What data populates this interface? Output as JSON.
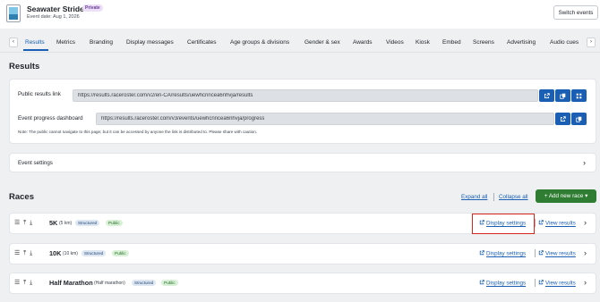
{
  "header": {
    "event_name": "Seawater Stride",
    "privacy_badge": "Private",
    "event_date": "Event date: Aug 1, 2026",
    "switch_label": "Switch events"
  },
  "tabs": {
    "prev_icon": "chevron-left-icon",
    "next_icon": "chevron-right-icon",
    "items": [
      "Results",
      "Metrics",
      "Branding",
      "Display messages",
      "Certificates",
      "Age groups & divisions",
      "Gender & sex",
      "Awards",
      "Videos",
      "Kiosk",
      "Embed",
      "Screens",
      "Advertising",
      "Audio cues"
    ],
    "active": "Results"
  },
  "page": {
    "title": "Results"
  },
  "links_card": {
    "public_label": "Public results link",
    "public_value": "https://results.raceroster.com/v2/en-CA/results/uewhcnncea6nhvja/results",
    "progress_label": "Event progress dashboard",
    "progress_value": "https://results.raceroster.com/v3/events/uewhcnncea6nhvja/progress",
    "note": "Note: The public cannot navigate to this page; but it can be accessed by anyone the link is distributed to. Please share with caution.",
    "icons": [
      "external-link-icon",
      "copy-icon",
      "qr-code-icon"
    ]
  },
  "event_settings": {
    "label": "Event settings"
  },
  "races_section": {
    "title": "Races",
    "expand_all": "Expand all",
    "collapse_all": "Collapse all",
    "add_new": "+ Add new race",
    "races": [
      {
        "name": "5K",
        "sub": "(5 km)",
        "tags": [
          "Structured",
          "Public"
        ],
        "display_settings": "Display settings",
        "view_results": "View results"
      },
      {
        "name": "10K",
        "sub": "(10 km)",
        "tags": [
          "Structured",
          "Public"
        ],
        "display_settings": "Display settings",
        "view_results": "View results"
      },
      {
        "name": "Half Marathon",
        "sub": "(Half marathon)",
        "tags": [
          "Structured",
          "Public"
        ],
        "display_settings": "Display settings",
        "view_results": "View results"
      }
    ]
  },
  "colors": {
    "accent": "#1a5fb4",
    "add_button": "#2e7d32",
    "highlight": "#d9261c"
  }
}
